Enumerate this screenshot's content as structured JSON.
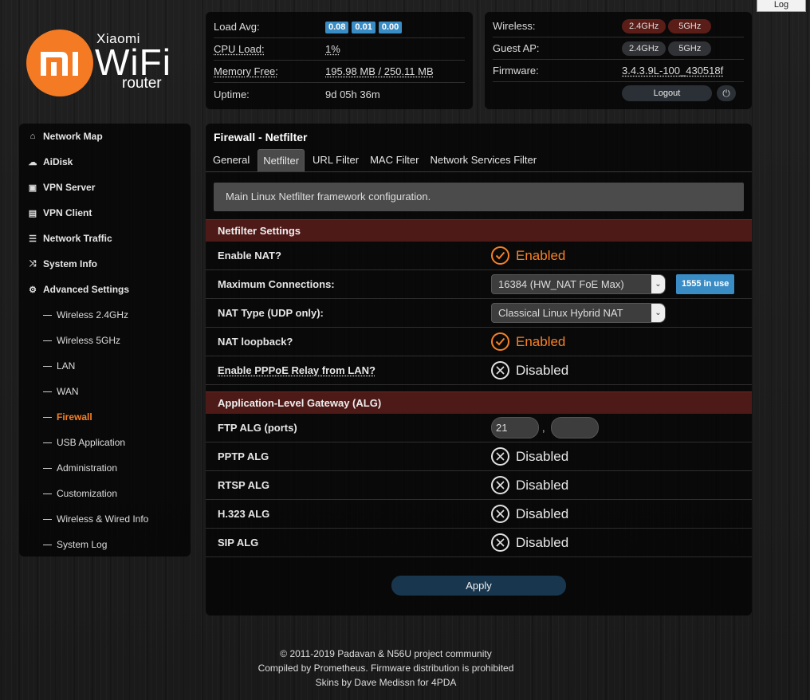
{
  "top_button": "Log",
  "logo": {
    "brand": "Xiaomi",
    "product": "WiFi",
    "sub": "router",
    "glyph": "mi"
  },
  "status": {
    "load_avg_label": "Load Avg:",
    "load_avg": [
      "0.08",
      "0.01",
      "0.00"
    ],
    "cpu_label": "CPU Load:",
    "cpu_value": "1%",
    "mem_label": "Memory Free:",
    "mem_value": "195.98 MB / 250.11 MB",
    "uptime_label": "Uptime:",
    "uptime_value": "9d 05h 36m",
    "wireless_label": "Wireless:",
    "wireless_24": "2.4GHz",
    "wireless_5": "5GHz",
    "guest_label": "Guest AP:",
    "guest_24": "2.4GHz",
    "guest_5": "5GHz",
    "firmware_label": "Firmware:",
    "firmware_value": "3.4.3.9L-100_430518f",
    "logout": "Logout"
  },
  "sidebar": {
    "items": [
      {
        "label": "Network Map",
        "icon": "home-icon"
      },
      {
        "label": "AiDisk",
        "icon": "cloud-icon"
      },
      {
        "label": "VPN Server",
        "icon": "vpn-server-icon"
      },
      {
        "label": "VPN Client",
        "icon": "vpn-client-icon"
      },
      {
        "label": "Network Traffic",
        "icon": "traffic-icon"
      },
      {
        "label": "System Info",
        "icon": "shuffle-icon"
      },
      {
        "label": "Advanced Settings",
        "icon": "gear-icon"
      }
    ],
    "sub": [
      "Wireless 2.4GHz",
      "Wireless 5GHz",
      "LAN",
      "WAN",
      "Firewall",
      "USB Application",
      "Administration",
      "Customization",
      "Wireless & Wired Info",
      "System Log"
    ],
    "active_sub": "Firewall"
  },
  "main": {
    "title": "Firewall - Netfilter",
    "tabs": [
      "General",
      "Netfilter",
      "URL Filter",
      "MAC Filter",
      "Network Services Filter"
    ],
    "active_tab": "Netfilter",
    "description": "Main Linux Netfilter framework configuration.",
    "section1": "Netfilter Settings",
    "nat_label": "Enable NAT?",
    "nat_state": "Enabled",
    "maxconn_label": "Maximum Connections:",
    "maxconn_value": "16384 (HW_NAT FoE Max)",
    "maxconn_inuse": "1555 in use",
    "nattype_label": "NAT Type (UDP only):",
    "nattype_value": "Classical Linux Hybrid NAT",
    "loopback_label": "NAT loopback?",
    "loopback_state": "Enabled",
    "pppoe_label": "Enable PPPoE Relay from LAN?",
    "pppoe_state": "Disabled",
    "section2": "Application-Level Gateway (ALG)",
    "ftp_label": "FTP ALG (ports)",
    "ftp_port1": "21",
    "ftp_port2": "",
    "pptp_label": "PPTP ALG",
    "pptp_state": "Disabled",
    "rtsp_label": "RTSP ALG",
    "rtsp_state": "Disabled",
    "h323_label": "H.323 ALG",
    "h323_state": "Disabled",
    "sip_label": "SIP ALG",
    "sip_state": "Disabled",
    "apply": "Apply"
  },
  "footer": [
    "© 2011-2019 Padavan & N56U project community",
    "Compiled by Prometheus. Firmware distribution is prohibited",
    "Skins by Dave Medissn for 4PDA"
  ],
  "colors": {
    "accent": "#f58025",
    "badge": "#3a8cc5",
    "section": "#4e1a18",
    "apply": "#18374f"
  }
}
